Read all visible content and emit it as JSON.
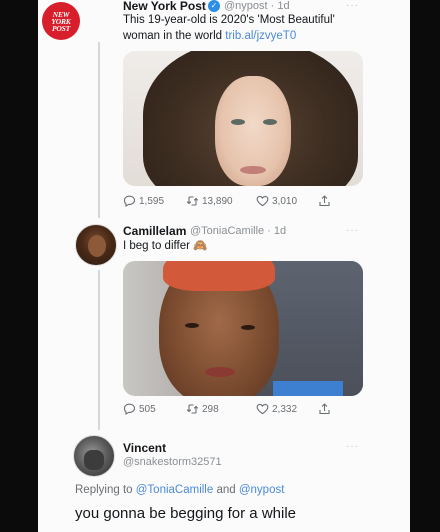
{
  "tweets": [
    {
      "author": "New York Post",
      "handle": "@nypost",
      "time": "1d",
      "logo_text": "NEW YORK POST",
      "text": "This 19-year-old is 2020's 'Most Beautiful' woman in the world",
      "text_line1": "This 19-year-old is 2020's 'Most Beautiful'",
      "text_line2": "woman in the world",
      "link": "trib.al/jzvyeT0",
      "replies": "1,595",
      "retweets": "13,890",
      "likes": "3,010"
    },
    {
      "author": "Camillelam",
      "handle": "@ToniaCamille",
      "time": "1d",
      "text": "I beg to differ",
      "replies": "505",
      "retweets": "298",
      "likes": "2,332"
    },
    {
      "author": "Vincent",
      "handle": "@snakestorm32571",
      "replying_prefix": "Replying to",
      "replying_to_1": "@ToniaCamille",
      "replying_and": "and",
      "replying_to_2": "@nypost",
      "text": "you gonna be begging for a while"
    }
  ],
  "more_label": "···",
  "colors": {
    "verified": "#2b8fe8",
    "link": "#4a8ad8",
    "logo": "#d81e2a"
  }
}
